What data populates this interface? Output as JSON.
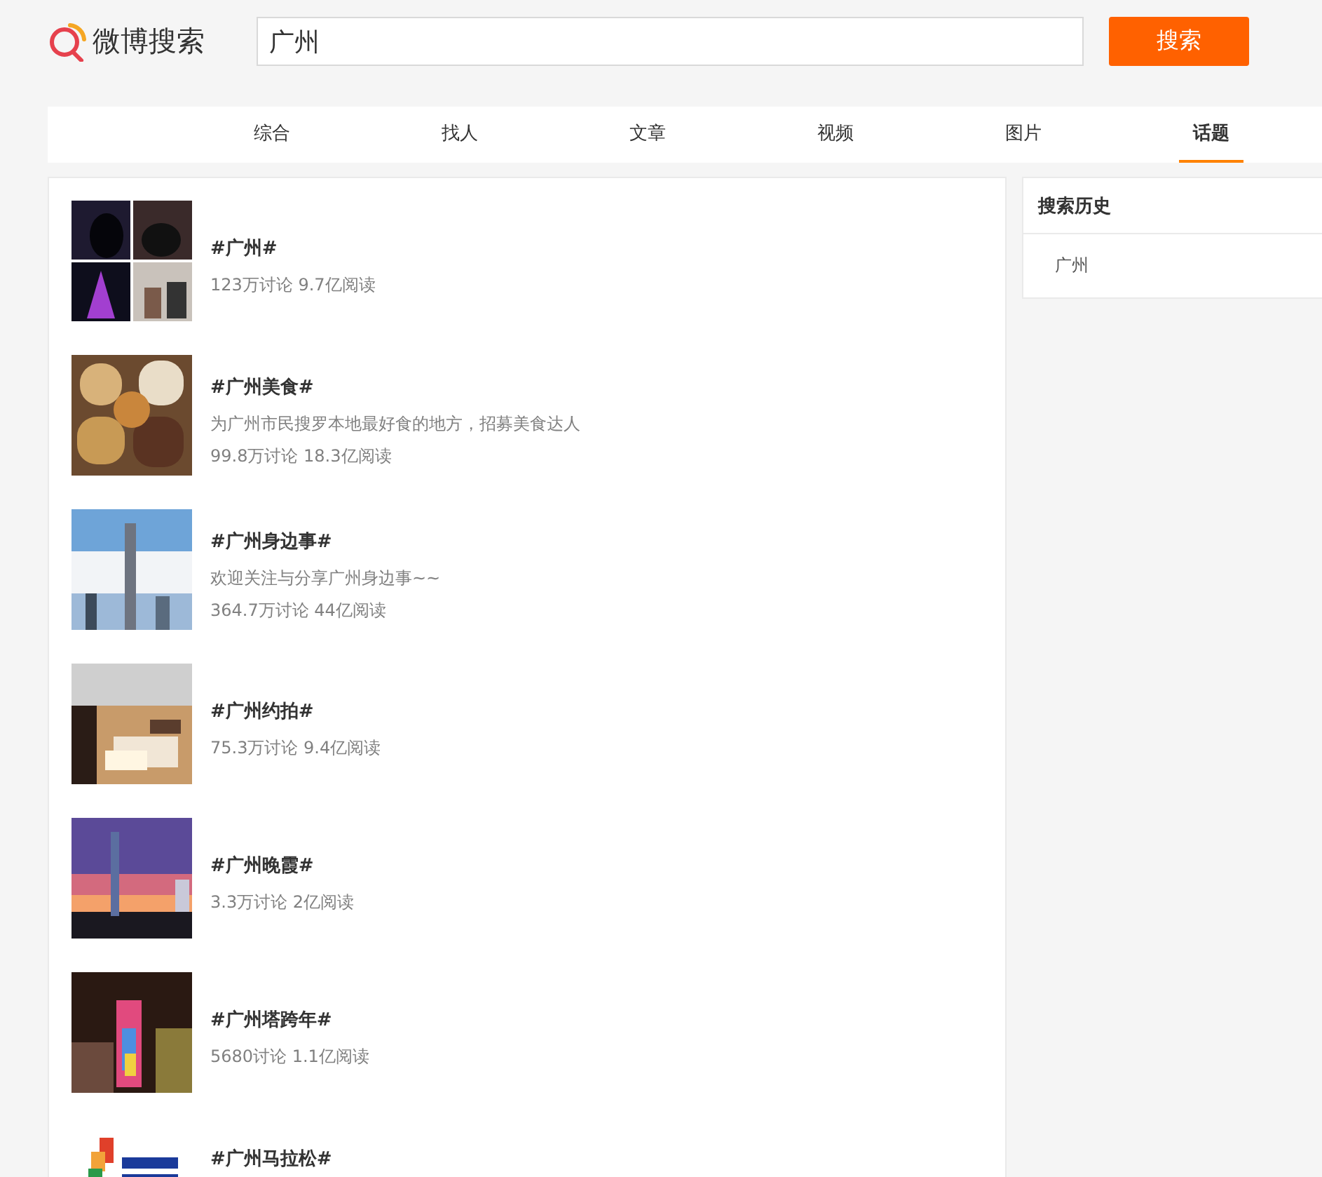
{
  "logo": {
    "text": "微博搜索"
  },
  "search": {
    "value": "广州",
    "button": "搜索"
  },
  "tabs": [
    {
      "label": "综合",
      "selected": false
    },
    {
      "label": "找人",
      "selected": false
    },
    {
      "label": "文章",
      "selected": false
    },
    {
      "label": "视频",
      "selected": false
    },
    {
      "label": "图片",
      "selected": false
    },
    {
      "label": "话题",
      "selected": true
    }
  ],
  "topics": [
    {
      "title": "#广州#",
      "meta": "123万讨论 9.7亿阅读",
      "image": {
        "kind": "collage"
      }
    },
    {
      "title": "#广州美食#",
      "description": "为广州市民搜罗本地最好食的地方，招募美食达人",
      "meta": "99.8万讨论 18.3亿阅读"
    },
    {
      "title": "#广州身边事#",
      "description": "欢迎关注与分享广州身边事~~",
      "meta": "364.7万讨论 44亿阅读"
    },
    {
      "title": "#广州约拍#",
      "meta": "75.3万讨论 9.4亿阅读"
    },
    {
      "title": "#广州晚霞#",
      "meta": "3.3万讨论 2亿阅读"
    },
    {
      "title": "#广州塔跨年#",
      "meta": "5680讨论 1.1亿阅读"
    },
    {
      "title": "#广州马拉松#"
    }
  ],
  "history": {
    "title": "搜索历史",
    "items": [
      "广州"
    ]
  }
}
